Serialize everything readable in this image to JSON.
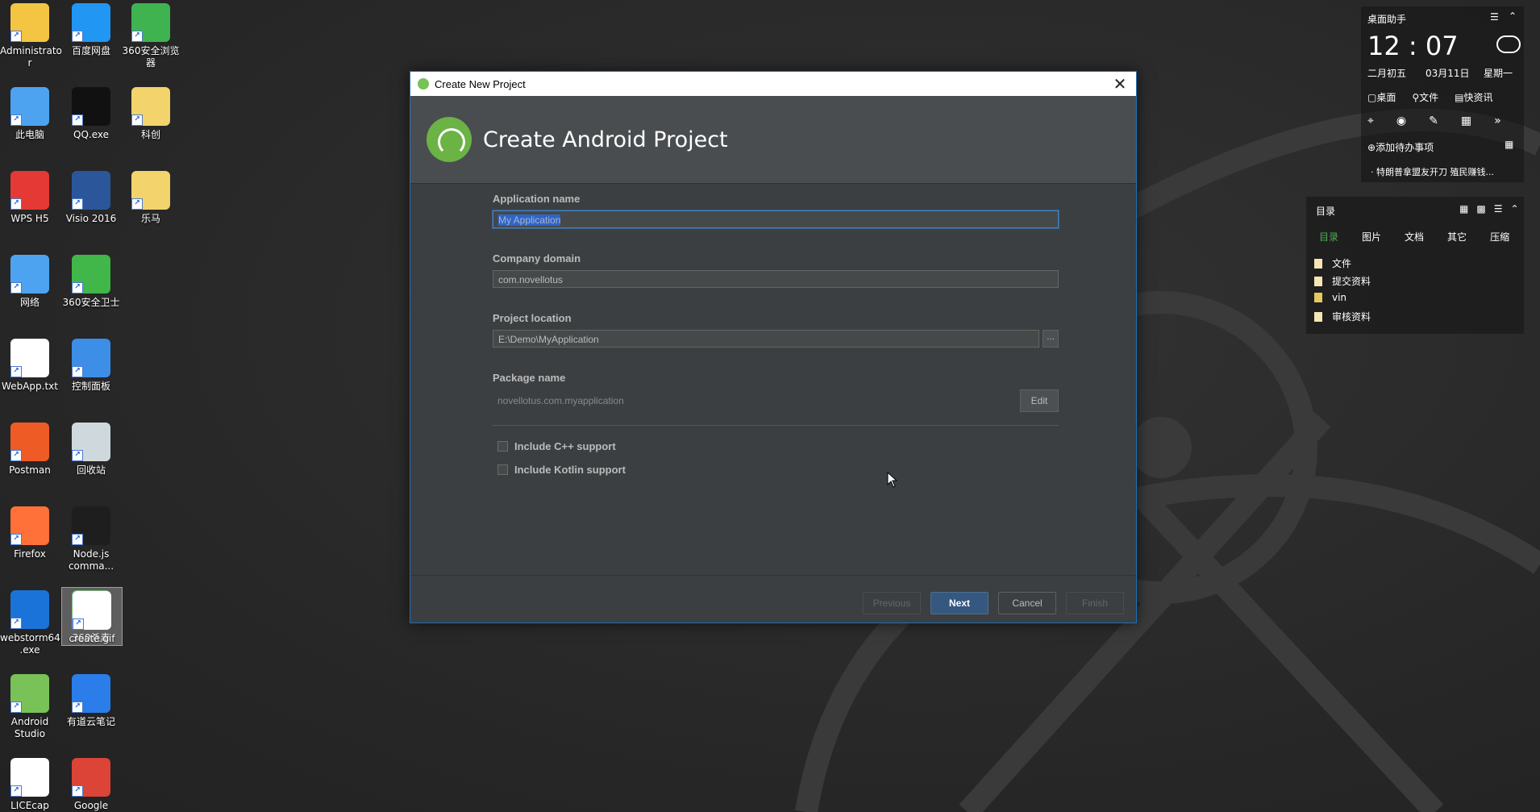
{
  "desktop": {
    "icons": [
      {
        "label": "Administrato\nr",
        "icon": "user-folder-icon",
        "color": "#f4c542"
      },
      {
        "label": "百度网盘",
        "icon": "baidu-cloud-icon",
        "color": "#2196f3"
      },
      {
        "label": "360安全浏览\n器",
        "icon": "360-browser-icon",
        "color": "#3fb34f"
      },
      {
        "label": "此电脑",
        "icon": "computer-icon",
        "color": "#4ea3f1"
      },
      {
        "label": "QQ.exe",
        "icon": "qq-icon",
        "color": "#111111"
      },
      {
        "label": "科创",
        "icon": "folder-icon",
        "color": "#f3d36b"
      },
      {
        "label": "WPS H5",
        "icon": "wps-h5-icon",
        "color": "#e53935"
      },
      {
        "label": "Visio 2016",
        "icon": "visio-icon",
        "color": "#2b579a"
      },
      {
        "label": "乐马",
        "icon": "folder-icon",
        "color": "#f3d36b"
      },
      {
        "label": "网络",
        "icon": "network-icon",
        "color": "#4ea3f1"
      },
      {
        "label": "360安全卫士",
        "icon": "360-security-icon",
        "color": "#41b649"
      },
      {
        "label": "WebApp.txt",
        "icon": "text-file-icon",
        "color": "#ffffff"
      },
      {
        "label": "控制面板",
        "icon": "control-panel-icon",
        "color": "#3c8ee6"
      },
      {
        "label": "Postman",
        "icon": "postman-icon",
        "color": "#ef5b25"
      },
      {
        "label": "回收站",
        "icon": "recycle-bin-icon",
        "color": "#cfd8dc"
      },
      {
        "label": "Firefox",
        "icon": "firefox-icon",
        "color": "#ff7139"
      },
      {
        "label": "Node.js\ncomma...",
        "icon": "nodejs-command-icon",
        "color": "#1e1e1e"
      },
      {
        "label": "webstorm64\n.exe",
        "icon": "webstorm-icon",
        "color": "#1a73d8"
      },
      {
        "label": "360杀毒",
        "icon": "360-antivirus-icon",
        "color": "#4caf50"
      },
      {
        "label": "Android\nStudio",
        "icon": "android-studio-icon",
        "color": "#78c257"
      },
      {
        "label": "有道云笔记",
        "icon": "youdao-note-icon",
        "color": "#2b7de9"
      },
      {
        "label": "LICEcap",
        "icon": "licecap-icon",
        "color": "#ffffff"
      },
      {
        "label": "Google",
        "icon": "chrome-icon",
        "color": "#db4437"
      },
      {
        "label": "create.gif",
        "icon": "gif-file-icon",
        "color": "#ffffff"
      }
    ]
  },
  "dialog": {
    "window_title": "Create New Project",
    "heading": "Create Android Project",
    "fields": {
      "app_name_label": "Application name",
      "app_name_value": "My Application",
      "company_domain_label": "Company domain",
      "company_domain_value": "com.novellotus",
      "project_location_label": "Project location",
      "project_location_value": "E:\\Demo\\MyApplication",
      "browse_label": "...",
      "package_name_label": "Package name",
      "package_name_value": "novellotus.com.myapplication",
      "edit_label": "Edit"
    },
    "options": {
      "cpp_label": "Include C++ support",
      "kotlin_label": "Include Kotlin support"
    },
    "buttons": {
      "previous": "Previous",
      "next": "Next",
      "cancel": "Cancel",
      "finish": "Finish"
    }
  },
  "assistant": {
    "title": "桌面助手",
    "time": "12 : 07",
    "lunar_date": "二月初五",
    "date": "03月11日",
    "weekday": "星期一",
    "tabs": [
      "桌面",
      "文件",
      "快资讯"
    ],
    "add_todo": "添加待办事项",
    "news": "特朗普拿盟友开刀 殖民赚钱..."
  },
  "folder_widget": {
    "title": "目录",
    "tabs": [
      "目录",
      "图片",
      "文档",
      "其它",
      "压缩"
    ],
    "files": [
      "文件",
      "提交资料",
      "vin",
      "审核资料"
    ]
  },
  "colors": {
    "accent_blue": "#365880",
    "android_green": "#78c257",
    "dialog_bg": "#3c3f41",
    "active_tab_green": "#4caf50"
  }
}
